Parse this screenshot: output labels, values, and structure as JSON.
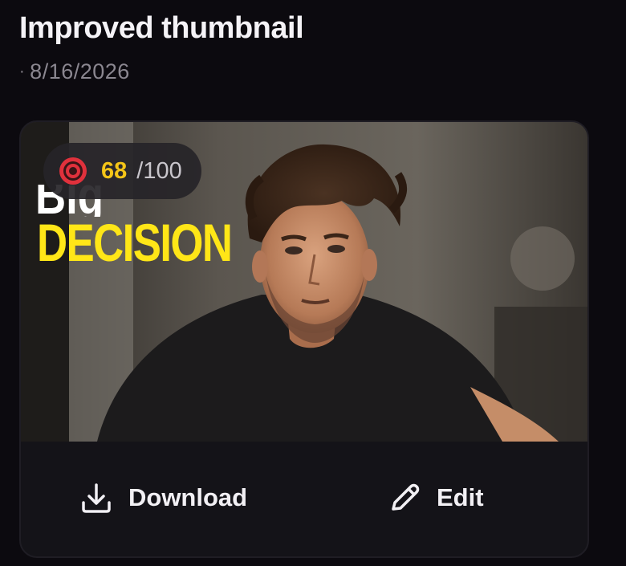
{
  "header": {
    "title": "Improved thumbnail",
    "date_prefix": "·",
    "date": "8/16/2026"
  },
  "thumbnail": {
    "headline_top": "Big",
    "headline": "DECISION",
    "headline_color": "#ffe617"
  },
  "score": {
    "icon": "target-icon",
    "value": "68",
    "max": "/100",
    "value_color": "#f5c518"
  },
  "actions": {
    "download_label": "Download",
    "download_icon": "download-icon",
    "edit_label": "Edit",
    "edit_icon": "pencil-icon"
  }
}
